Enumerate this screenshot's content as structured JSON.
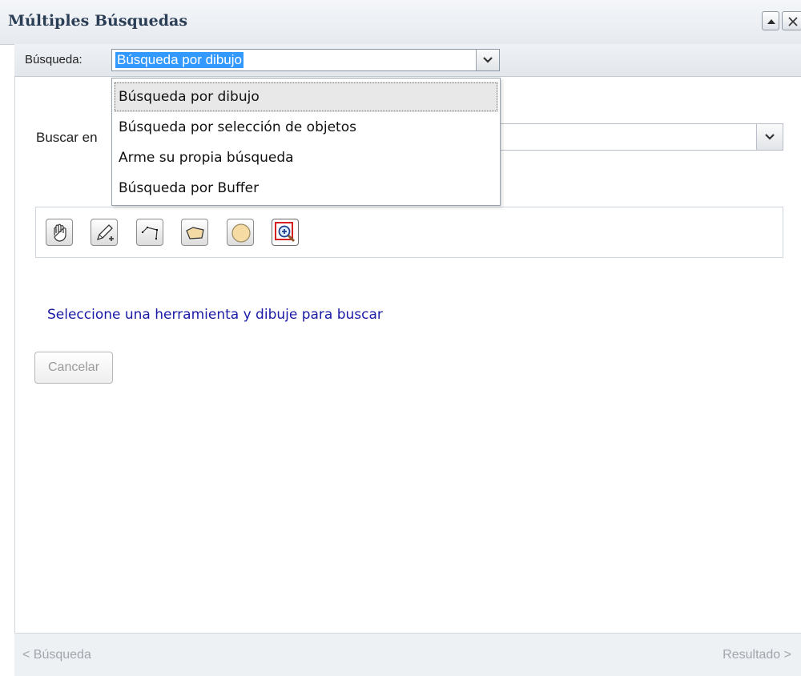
{
  "window": {
    "title": "Múltiples Búsquedas"
  },
  "search_selector": {
    "label": "Búsqueda:",
    "selected_value": "Búsqueda por dibujo",
    "options": [
      "Búsqueda por dibujo",
      "Búsqueda por selección de objetos",
      "Arme su propia búsqueda",
      "Búsqueda por Buffer"
    ]
  },
  "layer_selector": {
    "label": "Buscar en",
    "value": ""
  },
  "drawing_tools": [
    {
      "name": "pan-hand-icon"
    },
    {
      "name": "pencil-add-icon"
    },
    {
      "name": "polyline-icon"
    },
    {
      "name": "polygon-icon"
    },
    {
      "name": "circle-icon"
    },
    {
      "name": "zoom-in-icon",
      "active": true
    }
  ],
  "hint_text": "Seleccione una herramienta y dibuje para buscar",
  "cancel_label": "Cancelar",
  "navigation": {
    "prev_label": "< Búsqueda",
    "next_label": "Resultado >"
  },
  "colors": {
    "selection_highlight": "#3399ff",
    "hint_text": "#1a1aa6",
    "title_text": "#2b3e55"
  }
}
